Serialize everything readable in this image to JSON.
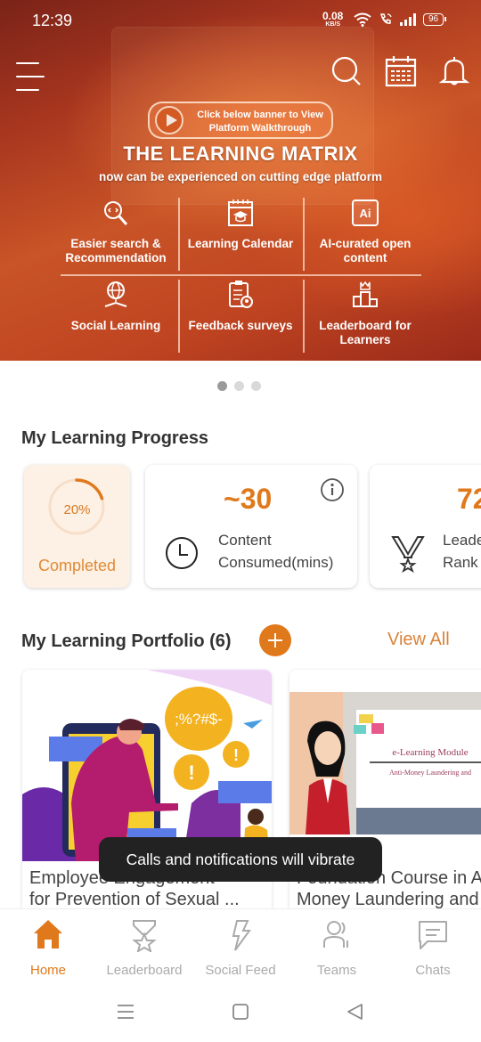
{
  "status_bar": {
    "time": "12:39",
    "net_speed": "0.08",
    "net_unit": "KB/S",
    "battery": "96"
  },
  "top_bar": {
    "menu_icon": "hamburger-menu-icon",
    "search_icon": "search-icon",
    "calendar_icon": "calendar-icon",
    "notification_icon": "bell-icon"
  },
  "banner": {
    "cta_text": "Click below banner to View Platform Walkthrough",
    "title": "THE LEARNING MATRIX",
    "subtitle": "now can be experienced on cutting edge platform",
    "features": [
      {
        "label": "Easier search & Recommendation",
        "icon": "search-code-icon"
      },
      {
        "label": "Learning Calendar",
        "icon": "calendar-graduation-icon"
      },
      {
        "label": "AI-curated open content",
        "icon": "ai-icon"
      },
      {
        "label": "Social Learning",
        "icon": "globe-book-icon"
      },
      {
        "label": "Feedback surveys",
        "icon": "clipboard-survey-icon"
      },
      {
        "label": "Leaderboard for Learners",
        "icon": "podium-crown-icon"
      }
    ],
    "pagination": {
      "total": 3,
      "active": 1
    }
  },
  "progress": {
    "title": "My Learning Progress",
    "completed": {
      "percent": 20,
      "percent_label": "20%",
      "label": "Completed"
    },
    "consumed": {
      "value": "~30",
      "label_line1": "Content",
      "label_line2": "Consumed(mins)"
    },
    "rank": {
      "value": "72",
      "label_line1": "Leaderboard",
      "label_line2": "Rank"
    }
  },
  "portfolio": {
    "title": "My Learning Portfolio (6)",
    "view_all": "View All",
    "items": [
      {
        "title_line1": "Employee Engagement",
        "title_line2": "for Prevention of Sexual ...",
        "bubble_text": ";%?#$-"
      },
      {
        "title_line1": "Foundation Course in Anti-",
        "title_line2": "Money Laundering and",
        "slide_title": "e-Learning Module",
        "slide_subtitle": "Anti-Money Laundering and"
      }
    ]
  },
  "toast": "Calls and notifications will vibrate",
  "bottom_nav": [
    {
      "label": "Home",
      "icon": "home-icon",
      "active": true
    },
    {
      "label": "Leaderboard",
      "icon": "medal-icon",
      "active": false
    },
    {
      "label": "Social Feed",
      "icon": "lightning-icon",
      "active": false
    },
    {
      "label": "Teams",
      "icon": "team-icon",
      "active": false
    },
    {
      "label": "Chats",
      "icon": "chat-icon",
      "active": false
    }
  ],
  "colors": {
    "accent": "#e0781c",
    "banner_base": "#c24a22",
    "completed_card_bg": "#fdf1e6",
    "nav_inactive": "#aaaaaa"
  }
}
